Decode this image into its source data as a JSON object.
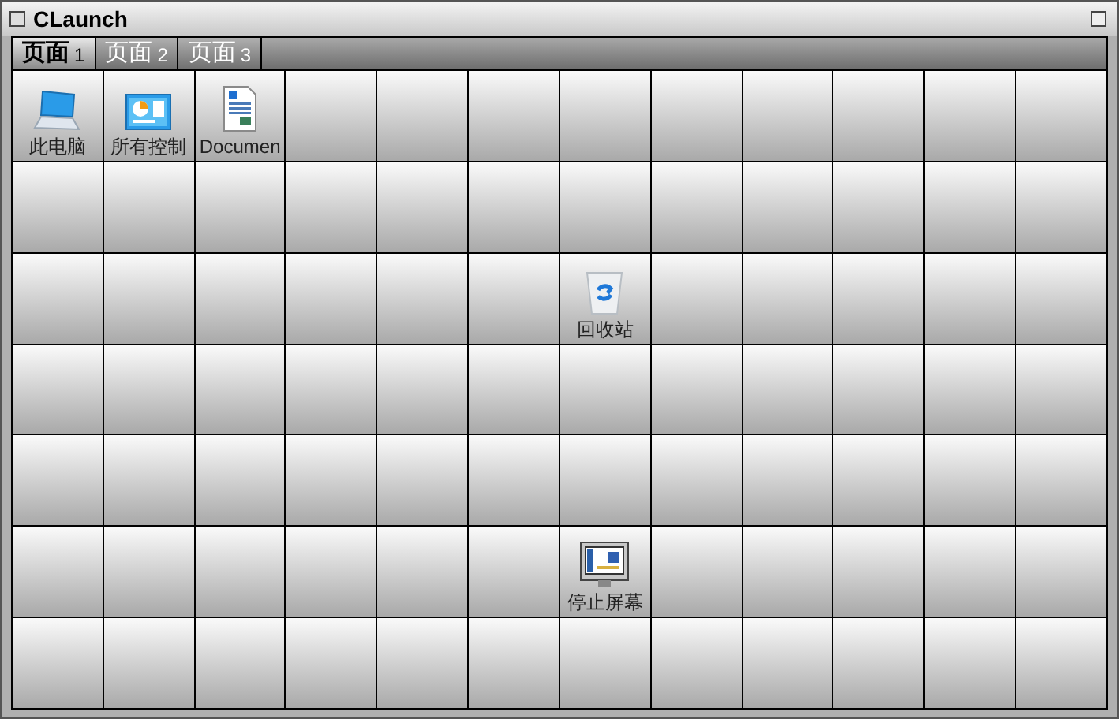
{
  "window": {
    "title": "CLaunch"
  },
  "tabs": [
    {
      "label": "页面",
      "number": "1",
      "selected": true
    },
    {
      "label": "页面",
      "number": "2",
      "selected": false
    },
    {
      "label": "页面",
      "number": "3",
      "selected": false
    }
  ],
  "grid": {
    "rows": [
      {
        "cells": [
          {
            "kind": "computer",
            "label": "此电脑"
          },
          {
            "kind": "controls",
            "label": "所有控制"
          },
          {
            "kind": "document",
            "label": "Documen"
          },
          {
            "kind": "empty"
          },
          {
            "kind": "empty"
          },
          {
            "kind": "empty"
          },
          {
            "kind": "empty"
          },
          {
            "kind": "empty"
          },
          {
            "kind": "empty"
          },
          {
            "kind": "empty"
          },
          {
            "kind": "empty"
          },
          {
            "kind": "empty"
          }
        ]
      },
      {
        "cells": [
          {
            "kind": "empty"
          },
          {
            "kind": "empty"
          },
          {
            "kind": "empty"
          },
          {
            "kind": "empty"
          },
          {
            "kind": "empty"
          },
          {
            "kind": "empty"
          },
          {
            "kind": "empty"
          },
          {
            "kind": "empty"
          },
          {
            "kind": "empty"
          },
          {
            "kind": "empty"
          },
          {
            "kind": "empty"
          },
          {
            "kind": "empty"
          }
        ]
      },
      {
        "cells": [
          {
            "kind": "empty"
          },
          {
            "kind": "empty"
          },
          {
            "kind": "empty"
          },
          {
            "kind": "empty"
          },
          {
            "kind": "empty"
          },
          {
            "kind": "empty"
          },
          {
            "kind": "trash",
            "label": "回收站"
          },
          {
            "kind": "empty"
          },
          {
            "kind": "empty"
          },
          {
            "kind": "empty"
          },
          {
            "kind": "empty"
          },
          {
            "kind": "empty"
          }
        ]
      },
      {
        "cells": [
          {
            "kind": "empty"
          },
          {
            "kind": "empty"
          },
          {
            "kind": "empty"
          },
          {
            "kind": "empty"
          },
          {
            "kind": "empty"
          },
          {
            "kind": "empty"
          },
          {
            "kind": "empty"
          },
          {
            "kind": "empty"
          },
          {
            "kind": "empty"
          },
          {
            "kind": "empty"
          },
          {
            "kind": "empty"
          },
          {
            "kind": "empty"
          }
        ]
      },
      {
        "cells": [
          {
            "kind": "empty"
          },
          {
            "kind": "empty"
          },
          {
            "kind": "empty"
          },
          {
            "kind": "empty"
          },
          {
            "kind": "empty"
          },
          {
            "kind": "empty"
          },
          {
            "kind": "empty"
          },
          {
            "kind": "empty"
          },
          {
            "kind": "empty"
          },
          {
            "kind": "empty"
          },
          {
            "kind": "empty"
          },
          {
            "kind": "empty"
          }
        ]
      },
      {
        "cells": [
          {
            "kind": "empty"
          },
          {
            "kind": "empty"
          },
          {
            "kind": "empty"
          },
          {
            "kind": "empty"
          },
          {
            "kind": "empty"
          },
          {
            "kind": "empty"
          },
          {
            "kind": "monitor",
            "label": "停止屏幕"
          },
          {
            "kind": "empty"
          },
          {
            "kind": "empty"
          },
          {
            "kind": "empty"
          },
          {
            "kind": "empty"
          },
          {
            "kind": "empty"
          }
        ]
      },
      {
        "cells": [
          {
            "kind": "empty"
          },
          {
            "kind": "empty"
          },
          {
            "kind": "empty"
          },
          {
            "kind": "empty"
          },
          {
            "kind": "empty"
          },
          {
            "kind": "empty"
          },
          {
            "kind": "empty"
          },
          {
            "kind": "empty"
          },
          {
            "kind": "empty"
          },
          {
            "kind": "empty"
          },
          {
            "kind": "empty"
          },
          {
            "kind": "empty"
          }
        ]
      }
    ]
  }
}
